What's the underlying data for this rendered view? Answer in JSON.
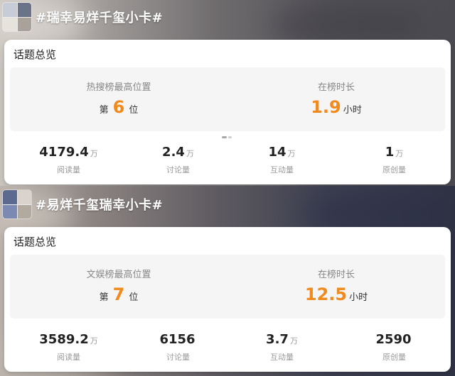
{
  "topics": [
    {
      "title": "#瑞幸易烊千玺小卡#",
      "card_title": "话题总览",
      "rank": {
        "label": "热搜榜最高位置",
        "prefix": "第",
        "value": "6",
        "suffix": "位"
      },
      "duration": {
        "label": "在榜时长",
        "value": "1.9",
        "unit": "小时"
      },
      "stats": [
        {
          "value": "4179.4",
          "unit": "万",
          "label": "阅读量"
        },
        {
          "value": "2.4",
          "unit": "万",
          "label": "讨论量"
        },
        {
          "value": "14",
          "unit": "万",
          "label": "互动量"
        },
        {
          "value": "1",
          "unit": "万",
          "label": "原创量"
        }
      ]
    },
    {
      "title": "#易烊千玺瑞幸小卡#",
      "card_title": "话题总览",
      "rank": {
        "label": "文娱榜最高位置",
        "prefix": "第",
        "value": "7",
        "suffix": "位"
      },
      "duration": {
        "label": "在榜时长",
        "value": "12.5",
        "unit": "小时"
      },
      "stats": [
        {
          "value": "3589.2",
          "unit": "万",
          "label": "阅读量"
        },
        {
          "value": "6156",
          "unit": "",
          "label": "讨论量"
        },
        {
          "value": "3.7",
          "unit": "万",
          "label": "互动量"
        },
        {
          "value": "2590",
          "unit": "",
          "label": "原创量"
        }
      ]
    }
  ],
  "colors": {
    "accent": "#f08a1c",
    "card_bg": "#ffffff",
    "panel_bg": "#f5f5f6"
  }
}
